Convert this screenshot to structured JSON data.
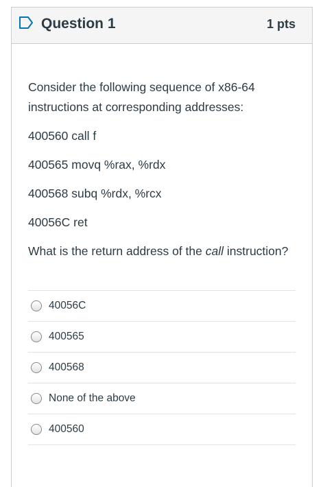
{
  "question": {
    "title": "Question 1",
    "points": "1 pts",
    "intro": "Consider the following sequence of x86-64 instructions at corresponding addresses:",
    "instructions": [
      "400560 call f",
      "400565 movq %rax, %rdx",
      "400568 subq %rdx, %rcx",
      "40056C ret"
    ],
    "prompt_before": "What is the return address of the ",
    "prompt_em": "call",
    "prompt_after": " instruction?"
  },
  "answers": [
    {
      "label": "40056C"
    },
    {
      "label": "400565"
    },
    {
      "label": "400568"
    },
    {
      "label": "None of the above"
    },
    {
      "label": "400560"
    }
  ],
  "icons": {
    "flag": "flag-icon"
  },
  "colors": {
    "text": "#2d3b45",
    "border": "#c7cdd1",
    "header_bg": "#f5f5f5",
    "accent": "#0374b5"
  }
}
